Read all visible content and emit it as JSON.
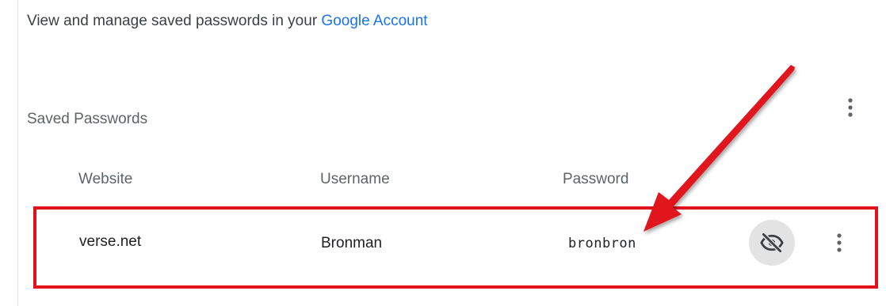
{
  "intro": {
    "text": "View and manage saved passwords in your ",
    "link": "Google Account"
  },
  "section": {
    "title": "Saved Passwords"
  },
  "columns": [
    "Website",
    "Username",
    "Password"
  ],
  "rows": [
    {
      "website": "verse.net",
      "username": "Bronman",
      "password": "bronbron"
    }
  ],
  "icons": {
    "header_more": "more-vert-icon",
    "visibility": "visibility-off-icon",
    "row_more": "more-vert-icon"
  },
  "colors": {
    "link": "#1a73e8",
    "highlight": "#e0121c",
    "icon_button_bg": "#e3e3e3"
  }
}
